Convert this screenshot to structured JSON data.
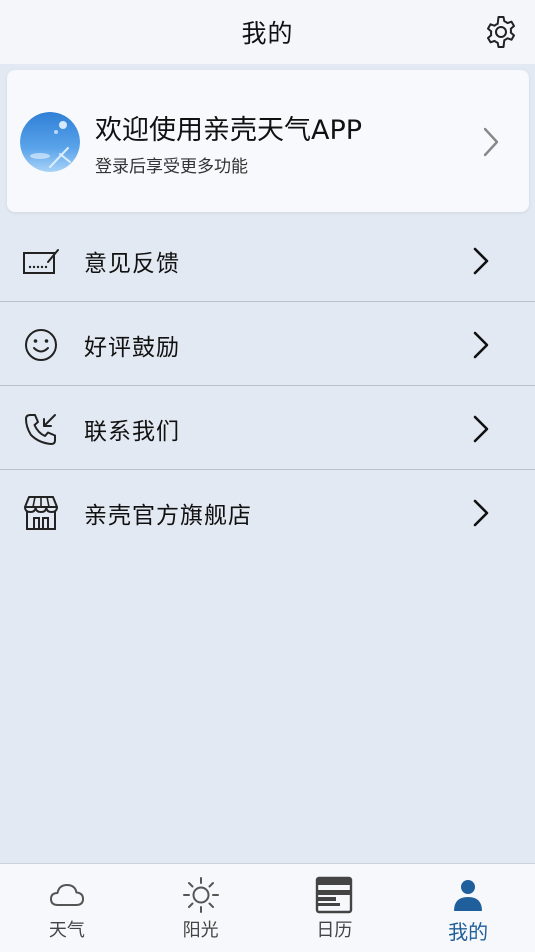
{
  "header": {
    "title": "我的",
    "settings_icon": "gear-icon"
  },
  "profile": {
    "welcome": "欢迎使用亲壳天气APP",
    "subtitle": "登录后享受更多功能",
    "avatar_icon": "sky-avatar"
  },
  "menu": {
    "items": [
      {
        "label": "意见反馈",
        "icon": "feedback-icon"
      },
      {
        "label": "好评鼓励",
        "icon": "smiley-icon"
      },
      {
        "label": "联系我们",
        "icon": "phone-incoming-icon"
      },
      {
        "label": "亲壳官方旗舰店",
        "icon": "store-icon"
      }
    ]
  },
  "tabs": [
    {
      "label": "天气",
      "icon": "cloud-icon"
    },
    {
      "label": "阳光",
      "icon": "sun-icon"
    },
    {
      "label": "日历",
      "icon": "calendar-icon"
    },
    {
      "label": "我的",
      "icon": "person-icon",
      "active": true
    }
  ],
  "colors": {
    "accent": "#1f5f9c",
    "background": "#e3e9f2",
    "card": "#f8f9fc",
    "header": "#f4f6fa"
  }
}
